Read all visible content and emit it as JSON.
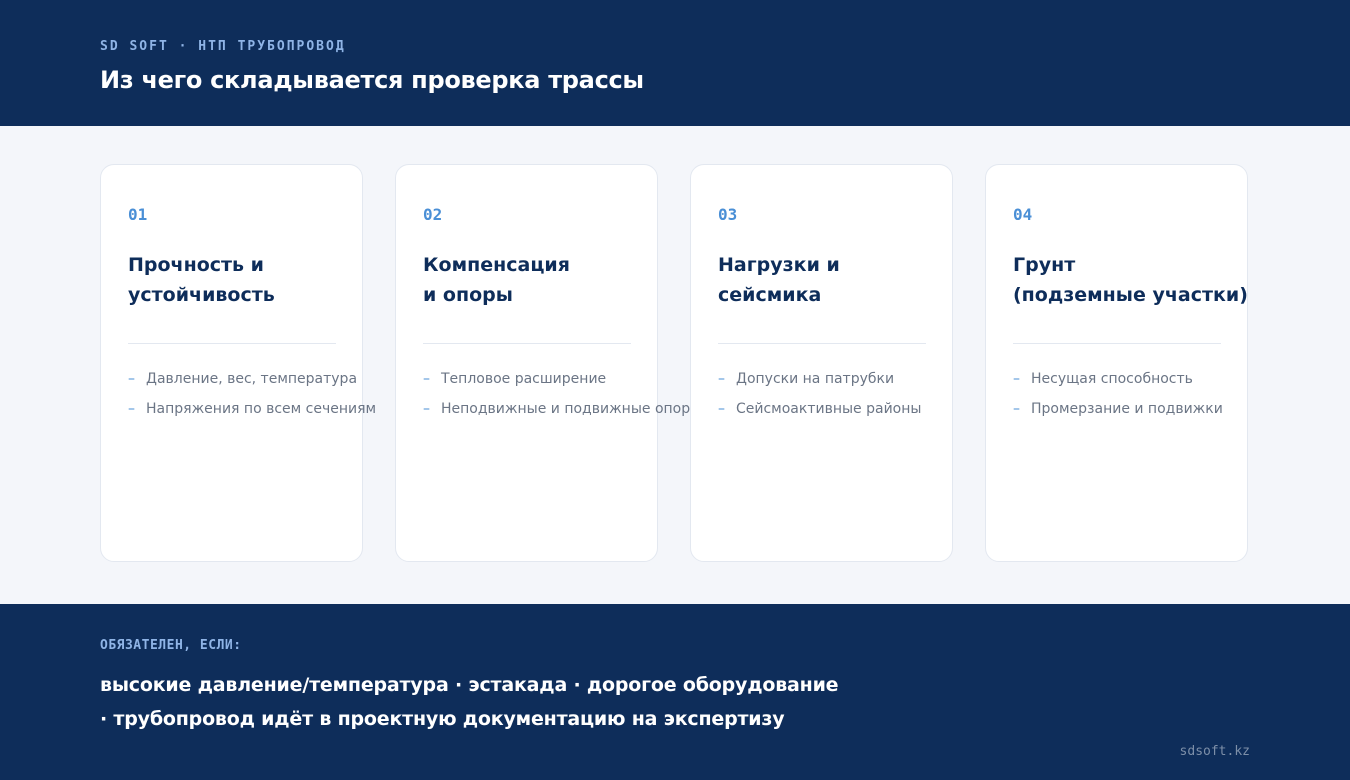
{
  "header": {
    "eyebrow": "SD SOFT · НТП ТРУБОПРОВОД",
    "title": "Из чего складывается проверка трассы"
  },
  "cards": [
    {
      "number": "01",
      "title_lines": [
        "Прочность и",
        "устойчивость"
      ],
      "items": [
        "Давление, вес, температура",
        "Напряжения по всем сечениям"
      ]
    },
    {
      "number": "02",
      "title_lines": [
        "Компенсация",
        "и опоры"
      ],
      "items": [
        "Тепловое расширение",
        "Неподвижные и подвижные опоры"
      ]
    },
    {
      "number": "03",
      "title_lines": [
        "Нагрузки и",
        "сейсмика"
      ],
      "items": [
        "Допуски на патрубки",
        "Сейсмоактивные районы"
      ]
    },
    {
      "number": "04",
      "title_lines": [
        "Грунт",
        "(подземные участки)"
      ],
      "items": [
        "Несущая способность",
        "Промерзание и подвижки"
      ]
    }
  ],
  "list_marker": "–",
  "footer": {
    "label": "ОБЯЗАТЕЛЕН, ЕСЛИ:",
    "line1": "высокие давление/температура · эстакада · дорогое оборудование",
    "line2": "· трубопровод идёт в проектную документацию на экспертизу",
    "site": "sdsoft.kz"
  },
  "colors": {
    "navy": "#0e2d5a",
    "accent": "#4a8fd6",
    "eyebrow": "#8fb4e6",
    "background": "#f4f6fa"
  }
}
